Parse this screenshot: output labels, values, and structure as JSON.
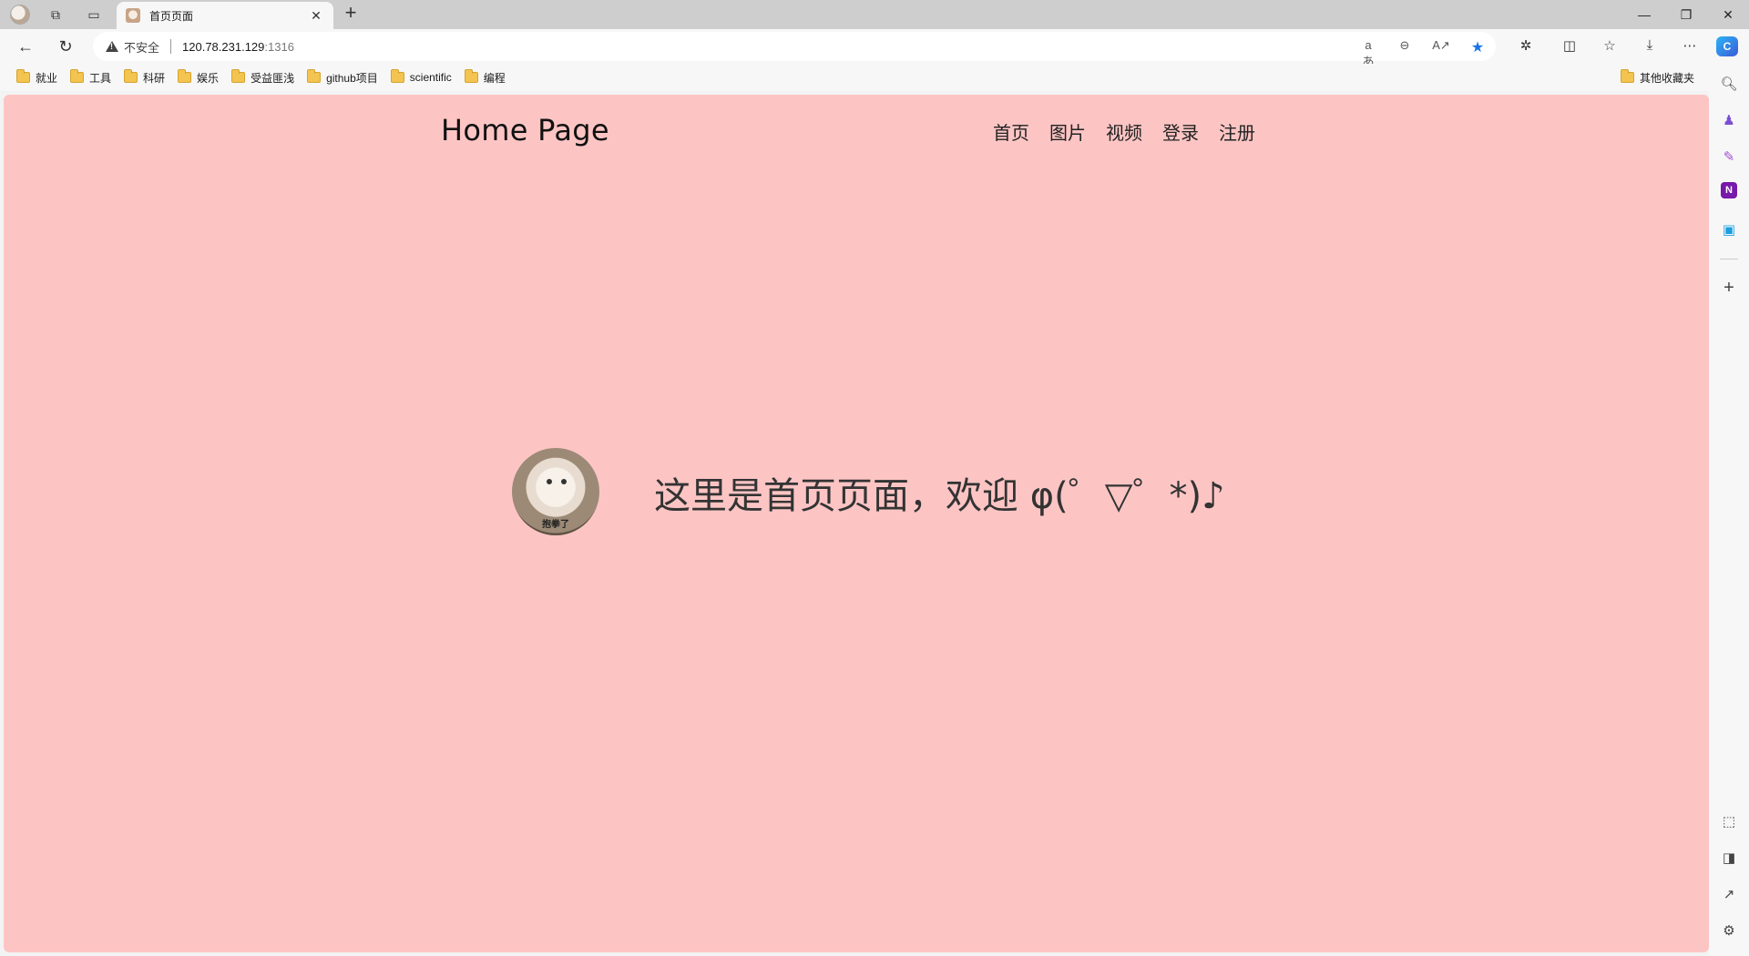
{
  "browser": {
    "tab": {
      "title": "首页页面"
    },
    "security_label": "不安全",
    "url_host": "120.78.231.129",
    "url_port": ":1316",
    "copilot_label": "C",
    "bookmarks": [
      "就业",
      "工具",
      "科研",
      "娱乐",
      "受益匪浅",
      "github项目",
      "scientific",
      "编程"
    ],
    "other_bookmarks": "其他收藏夹"
  },
  "page": {
    "site_title": "Home Page",
    "nav": [
      "首页",
      "图片",
      "视频",
      "登录",
      "注册"
    ],
    "avatar_caption": "抱拳了",
    "welcome": "这里是首页页面，欢迎 φ(゜▽゜*)♪"
  },
  "colors": {
    "page_background": "#fcc5c4",
    "chrome_background": "#f7f7f7",
    "tabstrip_background": "#cecece",
    "favorite_star": "#1a73e8"
  }
}
